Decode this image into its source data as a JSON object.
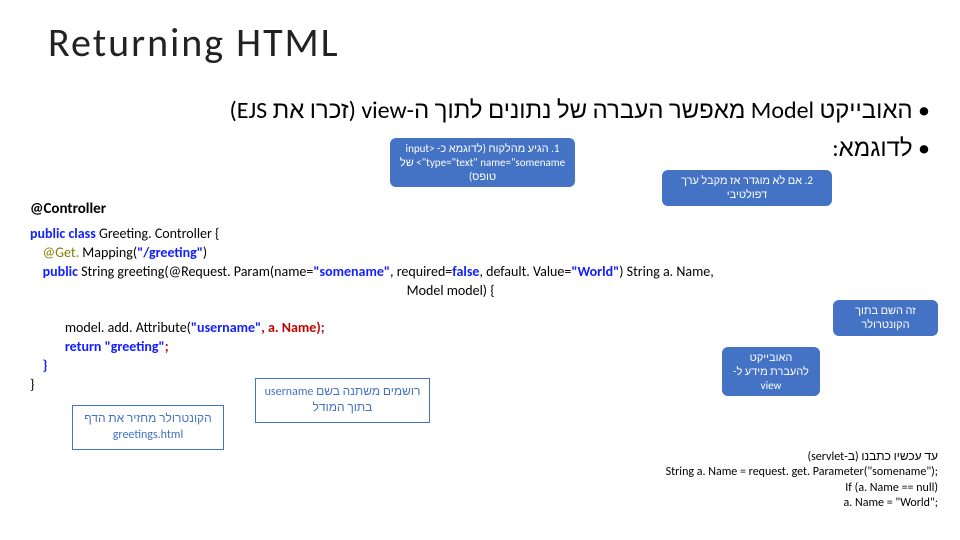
{
  "title": "Returning HTML",
  "bullets": {
    "b1": "• האובייקט Model מאפשר העברה של נתונים לתוך ה-view (זכרו את EJS)",
    "b2": "• לדוגמא:"
  },
  "callouts": {
    "c1": "1. הגיע מהלקוח (לדוגמא כ- <input type=\"text\" name=\"somename\"> של טופס)",
    "c2": "2. אם לא מוגדר אז מקבל ערך דפולטיבי",
    "c3": "זה השם בתוך הקונטרולר",
    "c4": "האובייקט להעברת מידע ל- view",
    "cf1": "רושמים משתנה בשם username בתוך המודל",
    "cf2": "הקונטרולר מחזיר את הדף greetings.html"
  },
  "code": {
    "controller_anno": "@Controller",
    "line1_a": "public class ",
    "line1_b": "Greeting. Controller {",
    "line2_a": "    @Get. ",
    "line2_b": "Mapping(",
    "line2_c": "\"/greeting\"",
    "line2_d": ")",
    "line3_a": "    public ",
    "line3_b": "String greeting(@Request. Param(name=",
    "line3_c": "\"somename\"",
    "line3_d": ", required=",
    "line3_e": "false",
    "line3_f": ", default. Value=",
    "line3_g": "\"World\"",
    "line3_h": ") String a. Name,",
    "line3_tail": "                                                                                                                       Model model) {",
    "line4_a": "           model. add. Attribute(",
    "line4_b": "\"username\"",
    "line4_c": ", a. Name);",
    "line5_a": "           return ",
    "line5_b": "\"greeting\"",
    "line5_c": ";",
    "line6": "    }",
    "line7": "}"
  },
  "servlet": {
    "head": "עד עכשיו כתבנו (ב-servlet)",
    "l1": "String a. Name = request. get. Parameter(\"somename\");",
    "l2": "If (a. Name == null)",
    "l3": "  a. Name = \"World\";"
  }
}
